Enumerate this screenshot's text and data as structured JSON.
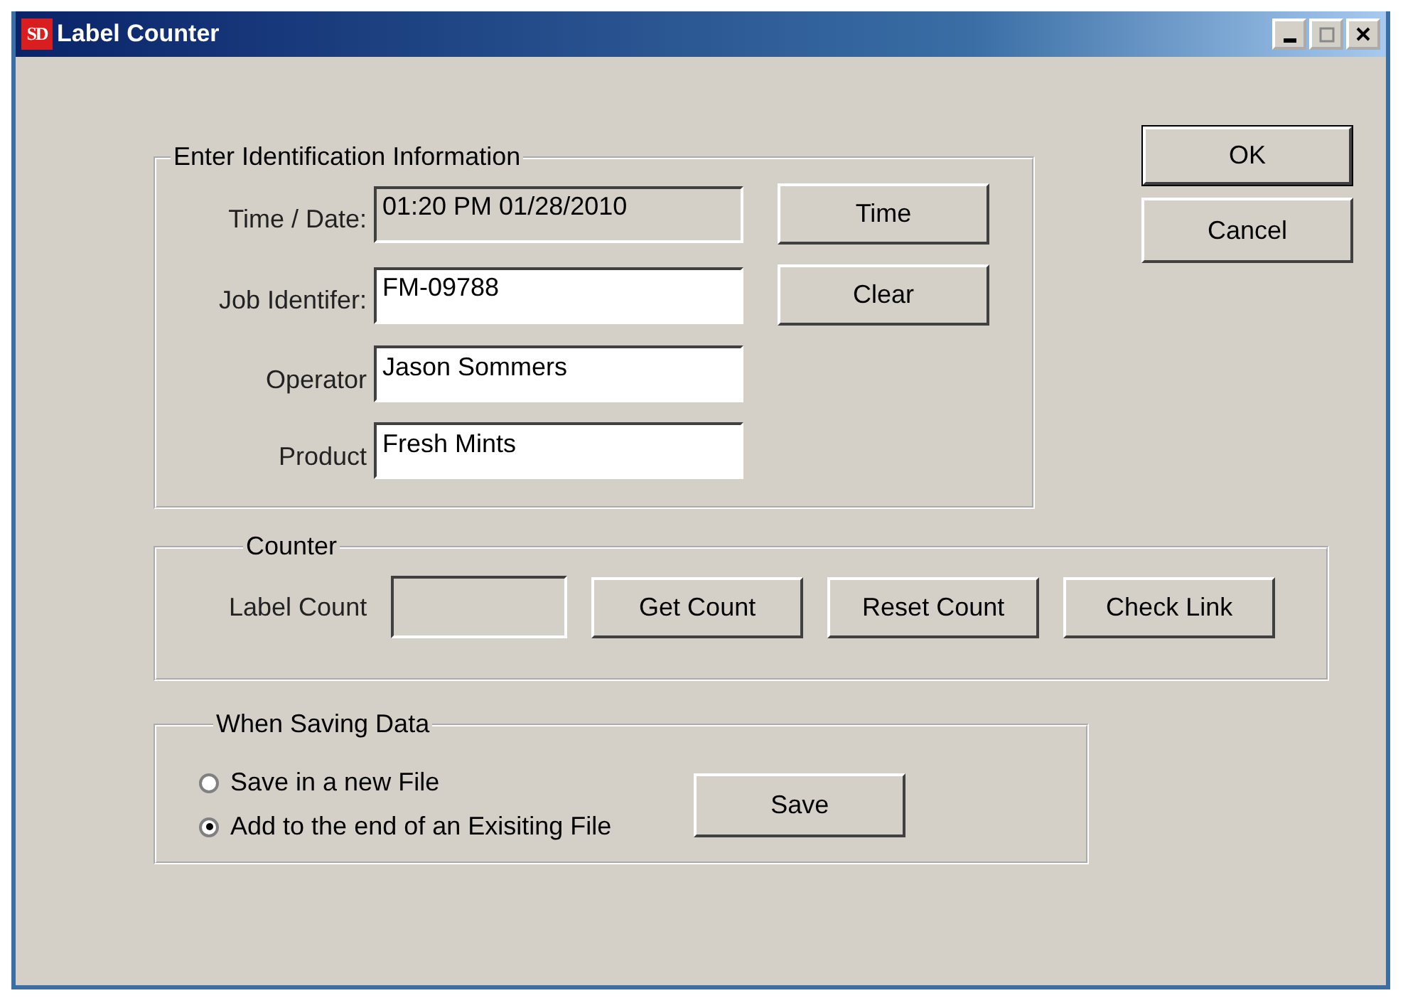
{
  "window": {
    "title": "Label Counter",
    "logo_text": "SD"
  },
  "dialog_buttons": [
    {
      "label": "OK",
      "default": true
    },
    {
      "label": "Cancel",
      "default": false
    }
  ],
  "identification": {
    "title": "Enter Identification Information",
    "fields": [
      {
        "label": "Time / Date:",
        "value": "01:20 PM 01/28/2010",
        "disabled": true
      },
      {
        "label": "Job Identifer:",
        "value": "FM-09788",
        "disabled": false
      },
      {
        "label": "Operator",
        "value": "Jason Sommers",
        "disabled": false
      },
      {
        "label": "Product",
        "value": "Fresh Mints",
        "disabled": false
      }
    ],
    "buttons": [
      "Time",
      "Clear"
    ]
  },
  "counter": {
    "title": "Counter",
    "label": "Label Count",
    "field": {
      "disabled": true
    },
    "buttons": [
      "Get Count",
      "Reset Count",
      "Check Link"
    ]
  },
  "saving": {
    "title": "When Saving Data",
    "options": [
      {
        "label": "Save in a new File",
        "selected": false
      },
      {
        "label": "Add to the end of an Exisiting File",
        "selected": true
      }
    ],
    "button": "Save"
  }
}
